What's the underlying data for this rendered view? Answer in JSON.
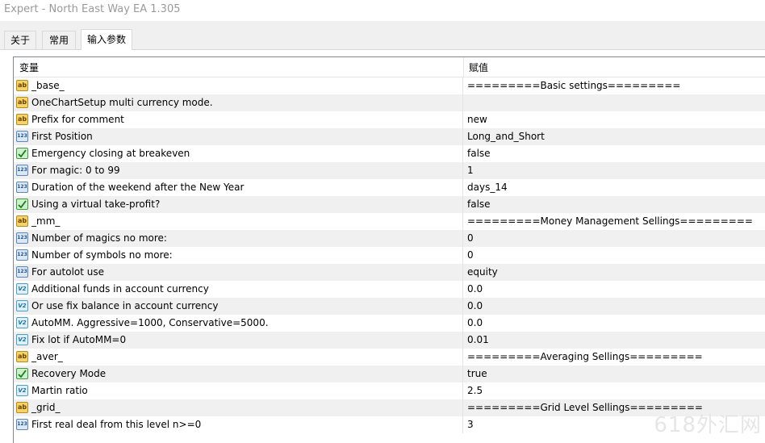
{
  "window": {
    "title": "Expert - North East Way EA 1.305"
  },
  "tabs": [
    {
      "label": "关于"
    },
    {
      "label": "常用"
    },
    {
      "label": "输入参数"
    }
  ],
  "grid": {
    "columns": {
      "variable": "变量",
      "value": "赋值"
    },
    "rows": [
      {
        "icon": "ab",
        "name": "_base_",
        "value": "=========Basic settings========="
      },
      {
        "icon": "ab",
        "name": "OneChartSetup multi currency mode.",
        "value": ""
      },
      {
        "icon": "ab",
        "name": "Prefix for comment",
        "value": "new"
      },
      {
        "icon": "123",
        "name": "First Position",
        "value": "Long_and_Short"
      },
      {
        "icon": "bool",
        "name": "Emergency closing at breakeven",
        "value": "false"
      },
      {
        "icon": "123",
        "name": "For magic: 0 to 99",
        "value": "1"
      },
      {
        "icon": "123",
        "name": "Duration of the weekend after the New Year",
        "value": "days_14"
      },
      {
        "icon": "bool",
        "name": "Using a virtual take-profit?",
        "value": "false"
      },
      {
        "icon": "ab",
        "name": "_mm_",
        "value": "=========Money Management Sellings========="
      },
      {
        "icon": "123",
        "name": "Number of magics no more:",
        "value": "0"
      },
      {
        "icon": "123",
        "name": "Number of symbols no more:",
        "value": "0"
      },
      {
        "icon": "123",
        "name": "For autolot use",
        "value": "equity"
      },
      {
        "icon": "V2",
        "name": "Additional funds in account currency",
        "value": "0.0"
      },
      {
        "icon": "V2",
        "name": "Or use fix balance in account currency",
        "value": "0.0"
      },
      {
        "icon": "V2",
        "name": "AutoMM. Aggressive=1000, Conservative=5000.",
        "value": "0.0"
      },
      {
        "icon": "V2",
        "name": "Fix lot if AutoMM=0",
        "value": "0.01"
      },
      {
        "icon": "ab",
        "name": "_aver_",
        "value": "=========Averaging Sellings========="
      },
      {
        "icon": "bool",
        "name": "Recovery Mode",
        "value": "true"
      },
      {
        "icon": "V2",
        "name": "Martin ratio",
        "value": "2.5"
      },
      {
        "icon": "ab",
        "name": "_grid_",
        "value": "=========Grid Level Sellings========="
      },
      {
        "icon": "123",
        "name": "First real deal from this level n>=0",
        "value": "3"
      }
    ]
  },
  "watermark": "618外汇网"
}
